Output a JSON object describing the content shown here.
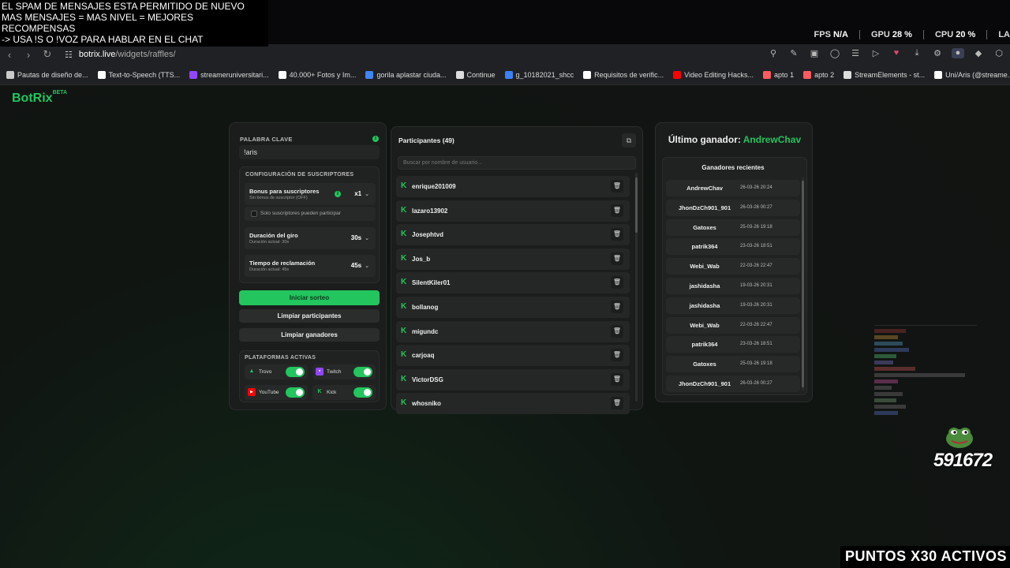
{
  "overlay": {
    "lines": [
      "EL SPAM DE MENSAJES ESTA PERMITIDO DE NUEVO",
      "MAS MENSAJES = MAS NIVEL = MEJORES RECOMPENSAS",
      "-> USA !S  O !VOZ PARA HABLAR EN EL CHAT"
    ],
    "bottom_banner": "PUNTOS X30 ACTIVOS",
    "counter": "591672"
  },
  "system_stats": {
    "fps_label": "FPS",
    "fps_value": "N/A",
    "gpu_label": "GPU",
    "gpu_value": "28 %",
    "cpu_label": "CPU",
    "cpu_value": "20 %",
    "extra": "LA"
  },
  "browser": {
    "url_host": "botrix.live",
    "url_path": "/widgets/raffles/",
    "bookmarks": [
      {
        "label": "Pautas de diseño de...",
        "icon": "bookmark-icon",
        "color": "#c9c9c9"
      },
      {
        "label": "Text-to-Speech (TTS...",
        "icon": "tts-icon",
        "color": "#ffffff"
      },
      {
        "label": "streameruniversitari...",
        "icon": "twitch-icon",
        "color": "#9146ff"
      },
      {
        "label": "40.000+ Fotos y Im...",
        "icon": "photo-icon",
        "color": "#ffffff"
      },
      {
        "label": "gorila aplastar ciuda...",
        "icon": "google-icon",
        "color": "#4285f4"
      },
      {
        "label": "Continue",
        "icon": "page-icon",
        "color": "#dddddd"
      },
      {
        "label": "g_10182021_shcc",
        "icon": "globe-icon",
        "color": "#3b82f6"
      },
      {
        "label": "Requisitos de verific...",
        "icon": "x-icon",
        "color": "#ffffff"
      },
      {
        "label": "Video Editing Hacks...",
        "icon": "youtube-icon",
        "color": "#ff0000"
      },
      {
        "label": "apto 1",
        "icon": "airbnb-icon",
        "color": "#ff5a5f"
      },
      {
        "label": "apto 2",
        "icon": "airbnb-icon",
        "color": "#ff5a5f"
      },
      {
        "label": "StreamElements - st...",
        "icon": "streamelements-icon",
        "color": "#dddddd"
      },
      {
        "label": "Uni/Aris (@streame...",
        "icon": "tiktok-icon",
        "color": "#ffffff"
      }
    ]
  },
  "app": {
    "logo": "BotRix",
    "logo_badge": "BETA",
    "accent": "#22c55e"
  },
  "settings": {
    "keyword_label": "PALABRA CLAVE",
    "keyword_value": "!aris",
    "subscribers_title": "CONFIGURACIÓN DE SUSCRIPTORES",
    "bonus_title": "Bonus para suscriptores",
    "bonus_sub": "Sin bonus de suscriptor (OFF)",
    "bonus_value": "x1",
    "subs_only_label": "Solo suscriptores pueden participar",
    "spin_title": "Duración del giro",
    "spin_sub": "Duración actual: 30s",
    "spin_value": "30s",
    "claim_title": "Tiempo de reclamación",
    "claim_sub": "Duración actual: 45s",
    "claim_value": "45s",
    "start_button": "Iniciar sorteo",
    "clear_participants_button": "Limpiar participantes",
    "clear_winners_button": "Limpiar ganadores",
    "platforms_title": "PLATAFORMAS ACTIVAS",
    "platforms": [
      {
        "name": "Trovo",
        "icon": "trovo-icon",
        "color": "#1ec76a",
        "enabled": true
      },
      {
        "name": "Twitch",
        "icon": "twitch-icon",
        "color": "#9146ff",
        "enabled": true
      },
      {
        "name": "YouTube",
        "icon": "youtube-icon",
        "color": "#ff0000",
        "enabled": true
      },
      {
        "name": "Kick",
        "icon": "kick-icon",
        "color": "#22c55e",
        "enabled": true
      }
    ]
  },
  "participants": {
    "title": "Participantes (49)",
    "search_placeholder": "Buscar por nombre de usuario...",
    "list": [
      "enrique201009",
      "lazaro13902",
      "Josephtvd",
      "Jos_b",
      "SilentKiler01",
      "bollanog",
      "migundc",
      "carjoaq",
      "VictorDSG",
      "whosniko"
    ]
  },
  "winners": {
    "last_winner_label": "Último ganador:",
    "last_winner_name": "AndrewChav",
    "recent_title": "Ganadores recientes",
    "list": [
      {
        "name": "AndrewChav",
        "date": "26-03-26 20:24"
      },
      {
        "name": "JhonDzCh901_901",
        "date": "26-03-26 00:27"
      },
      {
        "name": "Gatoxes",
        "date": "25-03-26 19:18"
      },
      {
        "name": "patrik364",
        "date": "23-03-26 18:51"
      },
      {
        "name": "Webi_Wab",
        "date": "22-03-26 22:47"
      },
      {
        "name": "jashidasha",
        "date": "19-03-26 20:31"
      },
      {
        "name": "jashidasha",
        "date": "19-03-26 20:31"
      },
      {
        "name": "Webi_Wab",
        "date": "22-03-26 22:47"
      },
      {
        "name": "patrik364",
        "date": "23-03-26 18:51"
      },
      {
        "name": "Gatoxes",
        "date": "25-03-26 19:18"
      },
      {
        "name": "JhonDzCh901_901",
        "date": "26-03-26 00:27"
      }
    ]
  }
}
